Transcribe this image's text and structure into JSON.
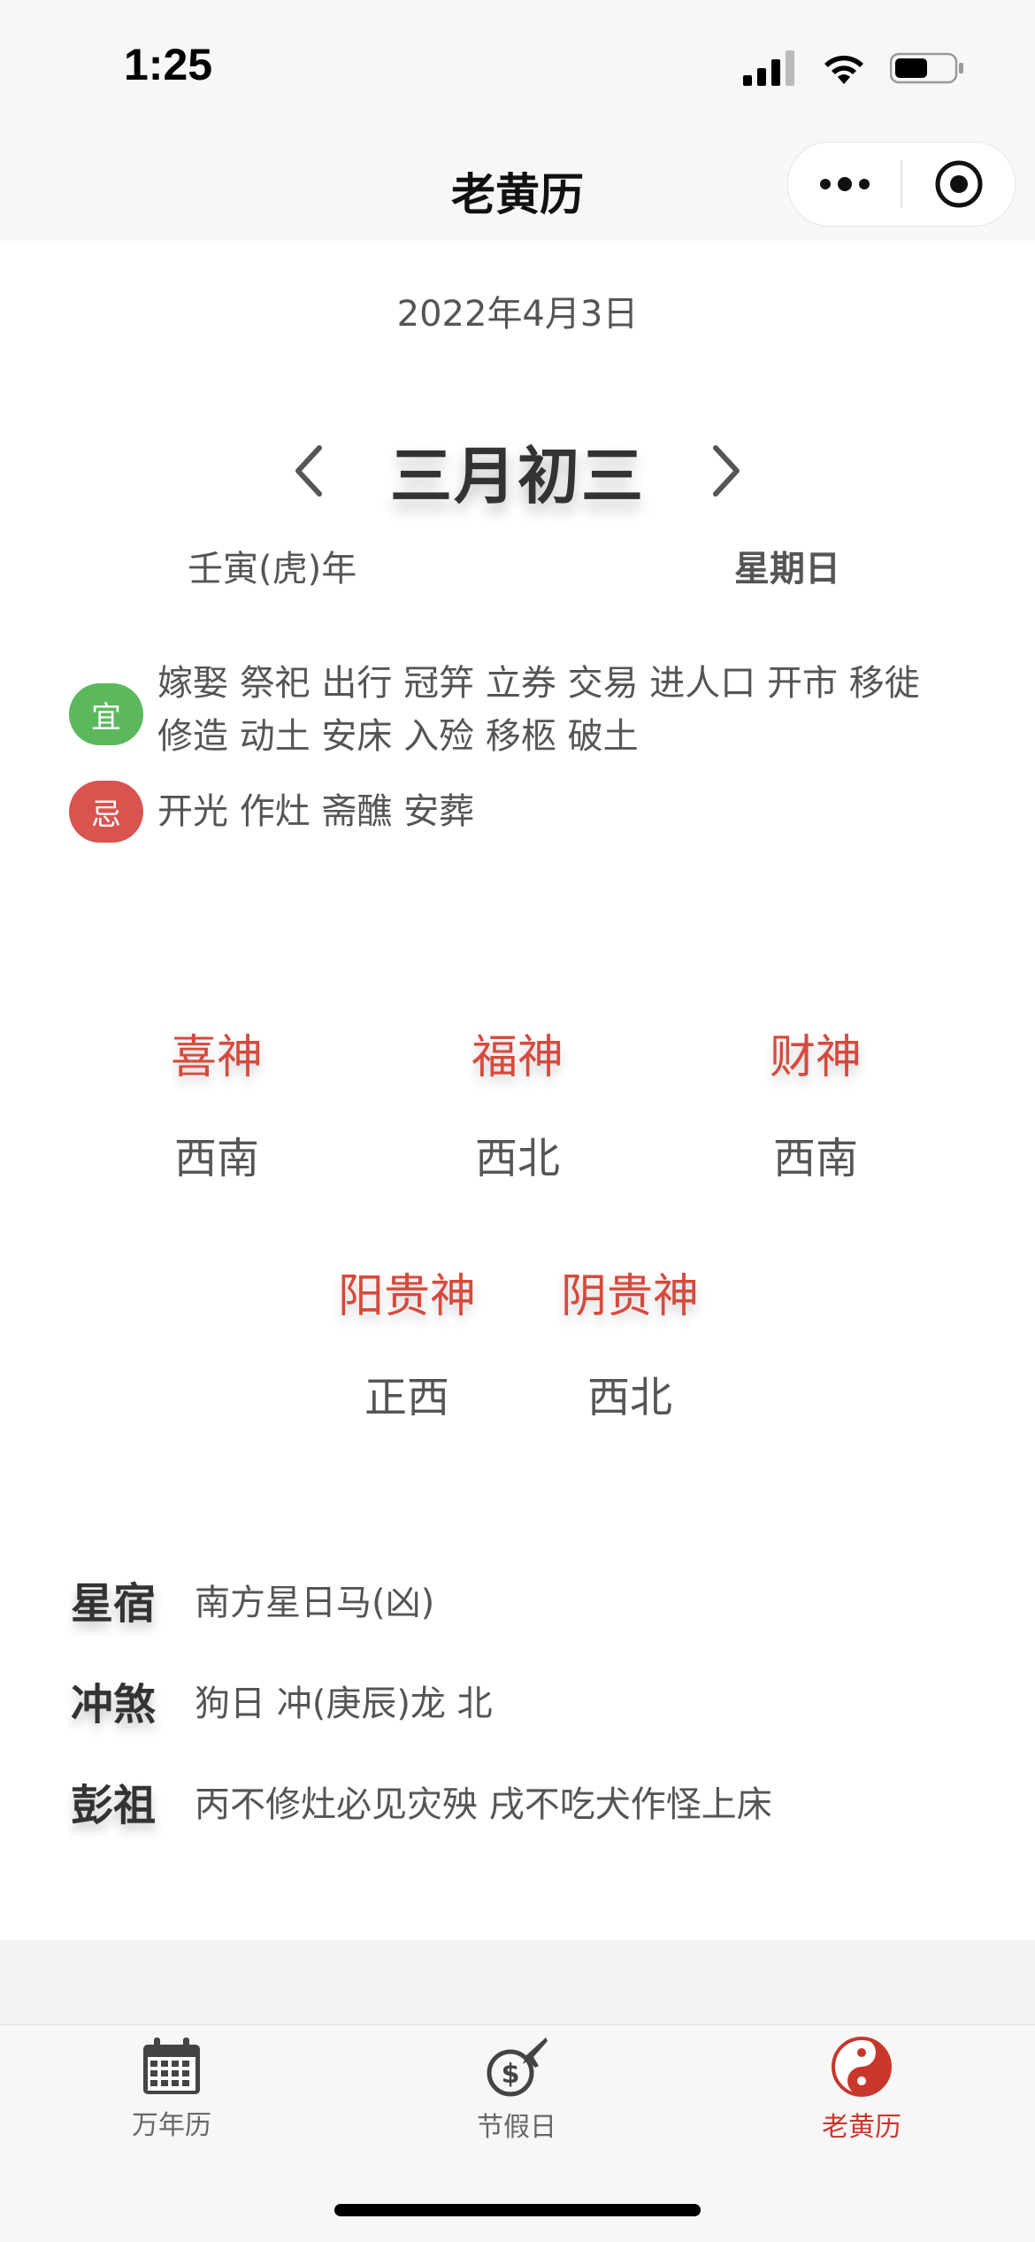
{
  "status_bar": {
    "time": "1:25"
  },
  "nav": {
    "title": "老黄历"
  },
  "date": {
    "solar": "2022年4月3日",
    "lunar": "三月初三",
    "year_ganzhi": "壬寅(虎)年",
    "weekday": "星期日"
  },
  "yi": {
    "badge": "宜",
    "line1": "嫁娶 祭祀 出行 冠笄 立券 交易 进人口 开市 移徙",
    "line2": "修造 动土 安床 入殓 移柩 破土"
  },
  "ji": {
    "badge": "忌",
    "text": "开光 作灶 斋醮 安葬"
  },
  "gods": [
    {
      "name": "喜神",
      "direction": "西南"
    },
    {
      "name": "福神",
      "direction": "西北"
    },
    {
      "name": "财神",
      "direction": "西南"
    },
    {
      "name": "阳贵神",
      "direction": "正西"
    },
    {
      "name": "阴贵神",
      "direction": "西北"
    }
  ],
  "info": [
    {
      "label": "星宿",
      "value": "南方星日马(凶)"
    },
    {
      "label": "冲煞",
      "value": "狗日 冲(庚辰)龙 北"
    },
    {
      "label": "彭祖",
      "value": "丙不修灶必见灾殃 戌不吃犬作怪上床"
    }
  ],
  "tabs": [
    {
      "label": "万年历",
      "icon": "calendar-icon"
    },
    {
      "label": "节假日",
      "icon": "holiday-money-plane-icon"
    },
    {
      "label": "老黄历",
      "icon": "yin-yang-icon"
    }
  ],
  "colors": {
    "accent_red": "#d64a3d",
    "yi_green": "#5cb85c",
    "ji_red": "#d9534f",
    "active_tab": "#c9372c"
  }
}
